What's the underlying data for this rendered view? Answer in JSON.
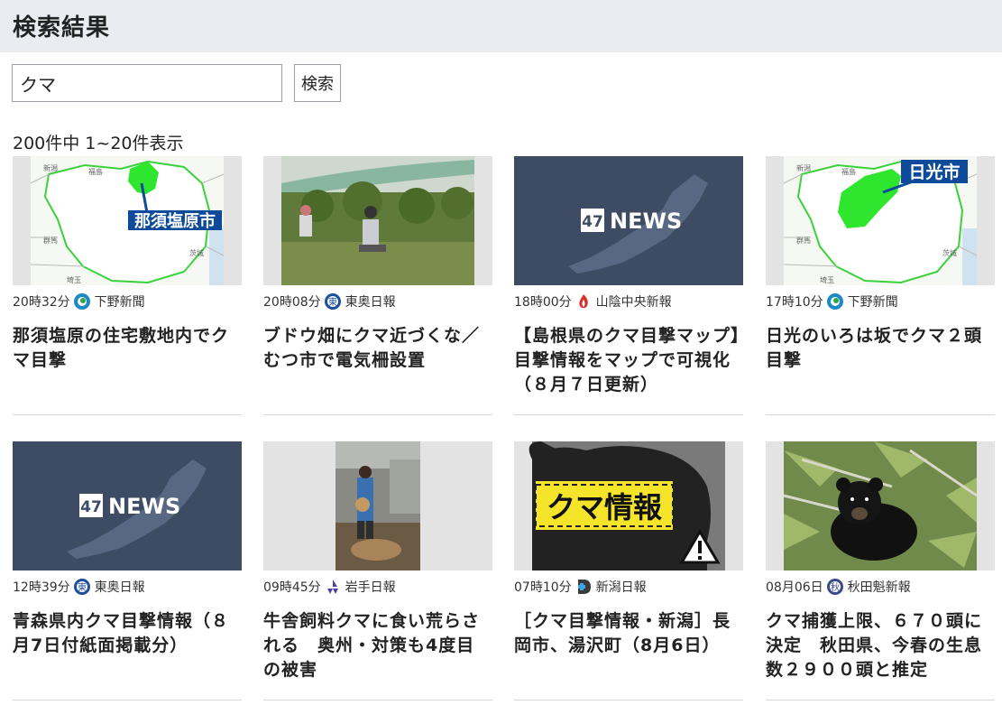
{
  "page": {
    "title": "検索結果"
  },
  "search": {
    "value": "クマ",
    "button_label": "検索"
  },
  "results": {
    "count_text": "200件中 1~20件表示",
    "items": [
      {
        "time": "20時32分",
        "source": "下野新聞",
        "source_icon": "shimotsuke-logo-icon",
        "headline": "那須塩原の住宅敷地内でクマ目撃",
        "thumb_icon": "map-nasushiobara-icon",
        "thumb_label": "那須塩原市"
      },
      {
        "time": "20時08分",
        "source": "東奥日報",
        "source_icon": "toonippo-logo-icon",
        "headline": "ブドウ畑にクマ近づくな／むつ市で電気柵設置",
        "thumb_icon": "vineyard-photo-icon",
        "thumb_label": ""
      },
      {
        "time": "18時00分",
        "source": "山陰中央新報",
        "source_icon": "sanin-chuo-logo-icon",
        "headline": "【島根県のクマ目撃マップ】目撃情報をマップで可視化（８月７日更新）",
        "thumb_icon": "47news-logo-icon",
        "thumb_label": "47 NEWS"
      },
      {
        "time": "17時10分",
        "source": "下野新聞",
        "source_icon": "shimotsuke-logo-icon",
        "headline": "日光のいろは坂でクマ２頭目撃",
        "thumb_icon": "map-nikko-icon",
        "thumb_label": "日光市"
      },
      {
        "time": "12時39分",
        "source": "東奥日報",
        "source_icon": "toonippo-logo-icon",
        "headline": "青森県内クマ目撃情報（８月7日付紙面掲載分）",
        "thumb_icon": "47news-logo-icon",
        "thumb_label": "47 NEWS"
      },
      {
        "time": "09時45分",
        "source": "岩手日報",
        "source_icon": "iwate-nippo-logo-icon",
        "headline": "牛舎飼料クマに食い荒らされる　奥州・対策も4度目の被害",
        "thumb_icon": "barn-photo-icon",
        "thumb_label": ""
      },
      {
        "time": "07時10分",
        "source": "新潟日報",
        "source_icon": "niigata-nippo-logo-icon",
        "headline": "［クマ目撃情報・新潟］長岡市、湯沢町（8月6日）",
        "thumb_icon": "bear-warning-icon",
        "thumb_label": "クマ情報"
      },
      {
        "time": "08月06日",
        "source": "秋田魁新報",
        "source_icon": "akita-sakigake-logo-icon",
        "headline": "クマ捕獲上限、６７０頭に決定　秋田県、今春の生息数２９００頭と推定",
        "thumb_icon": "black-bear-photo-icon",
        "thumb_label": ""
      }
    ]
  },
  "colors": {
    "header_bg": "#e9edf2",
    "map_green": "#2ee62e",
    "label_blue": "#0d4a9a",
    "news_bg": "#3d4b63",
    "warning_yellow": "#f5e52a"
  }
}
